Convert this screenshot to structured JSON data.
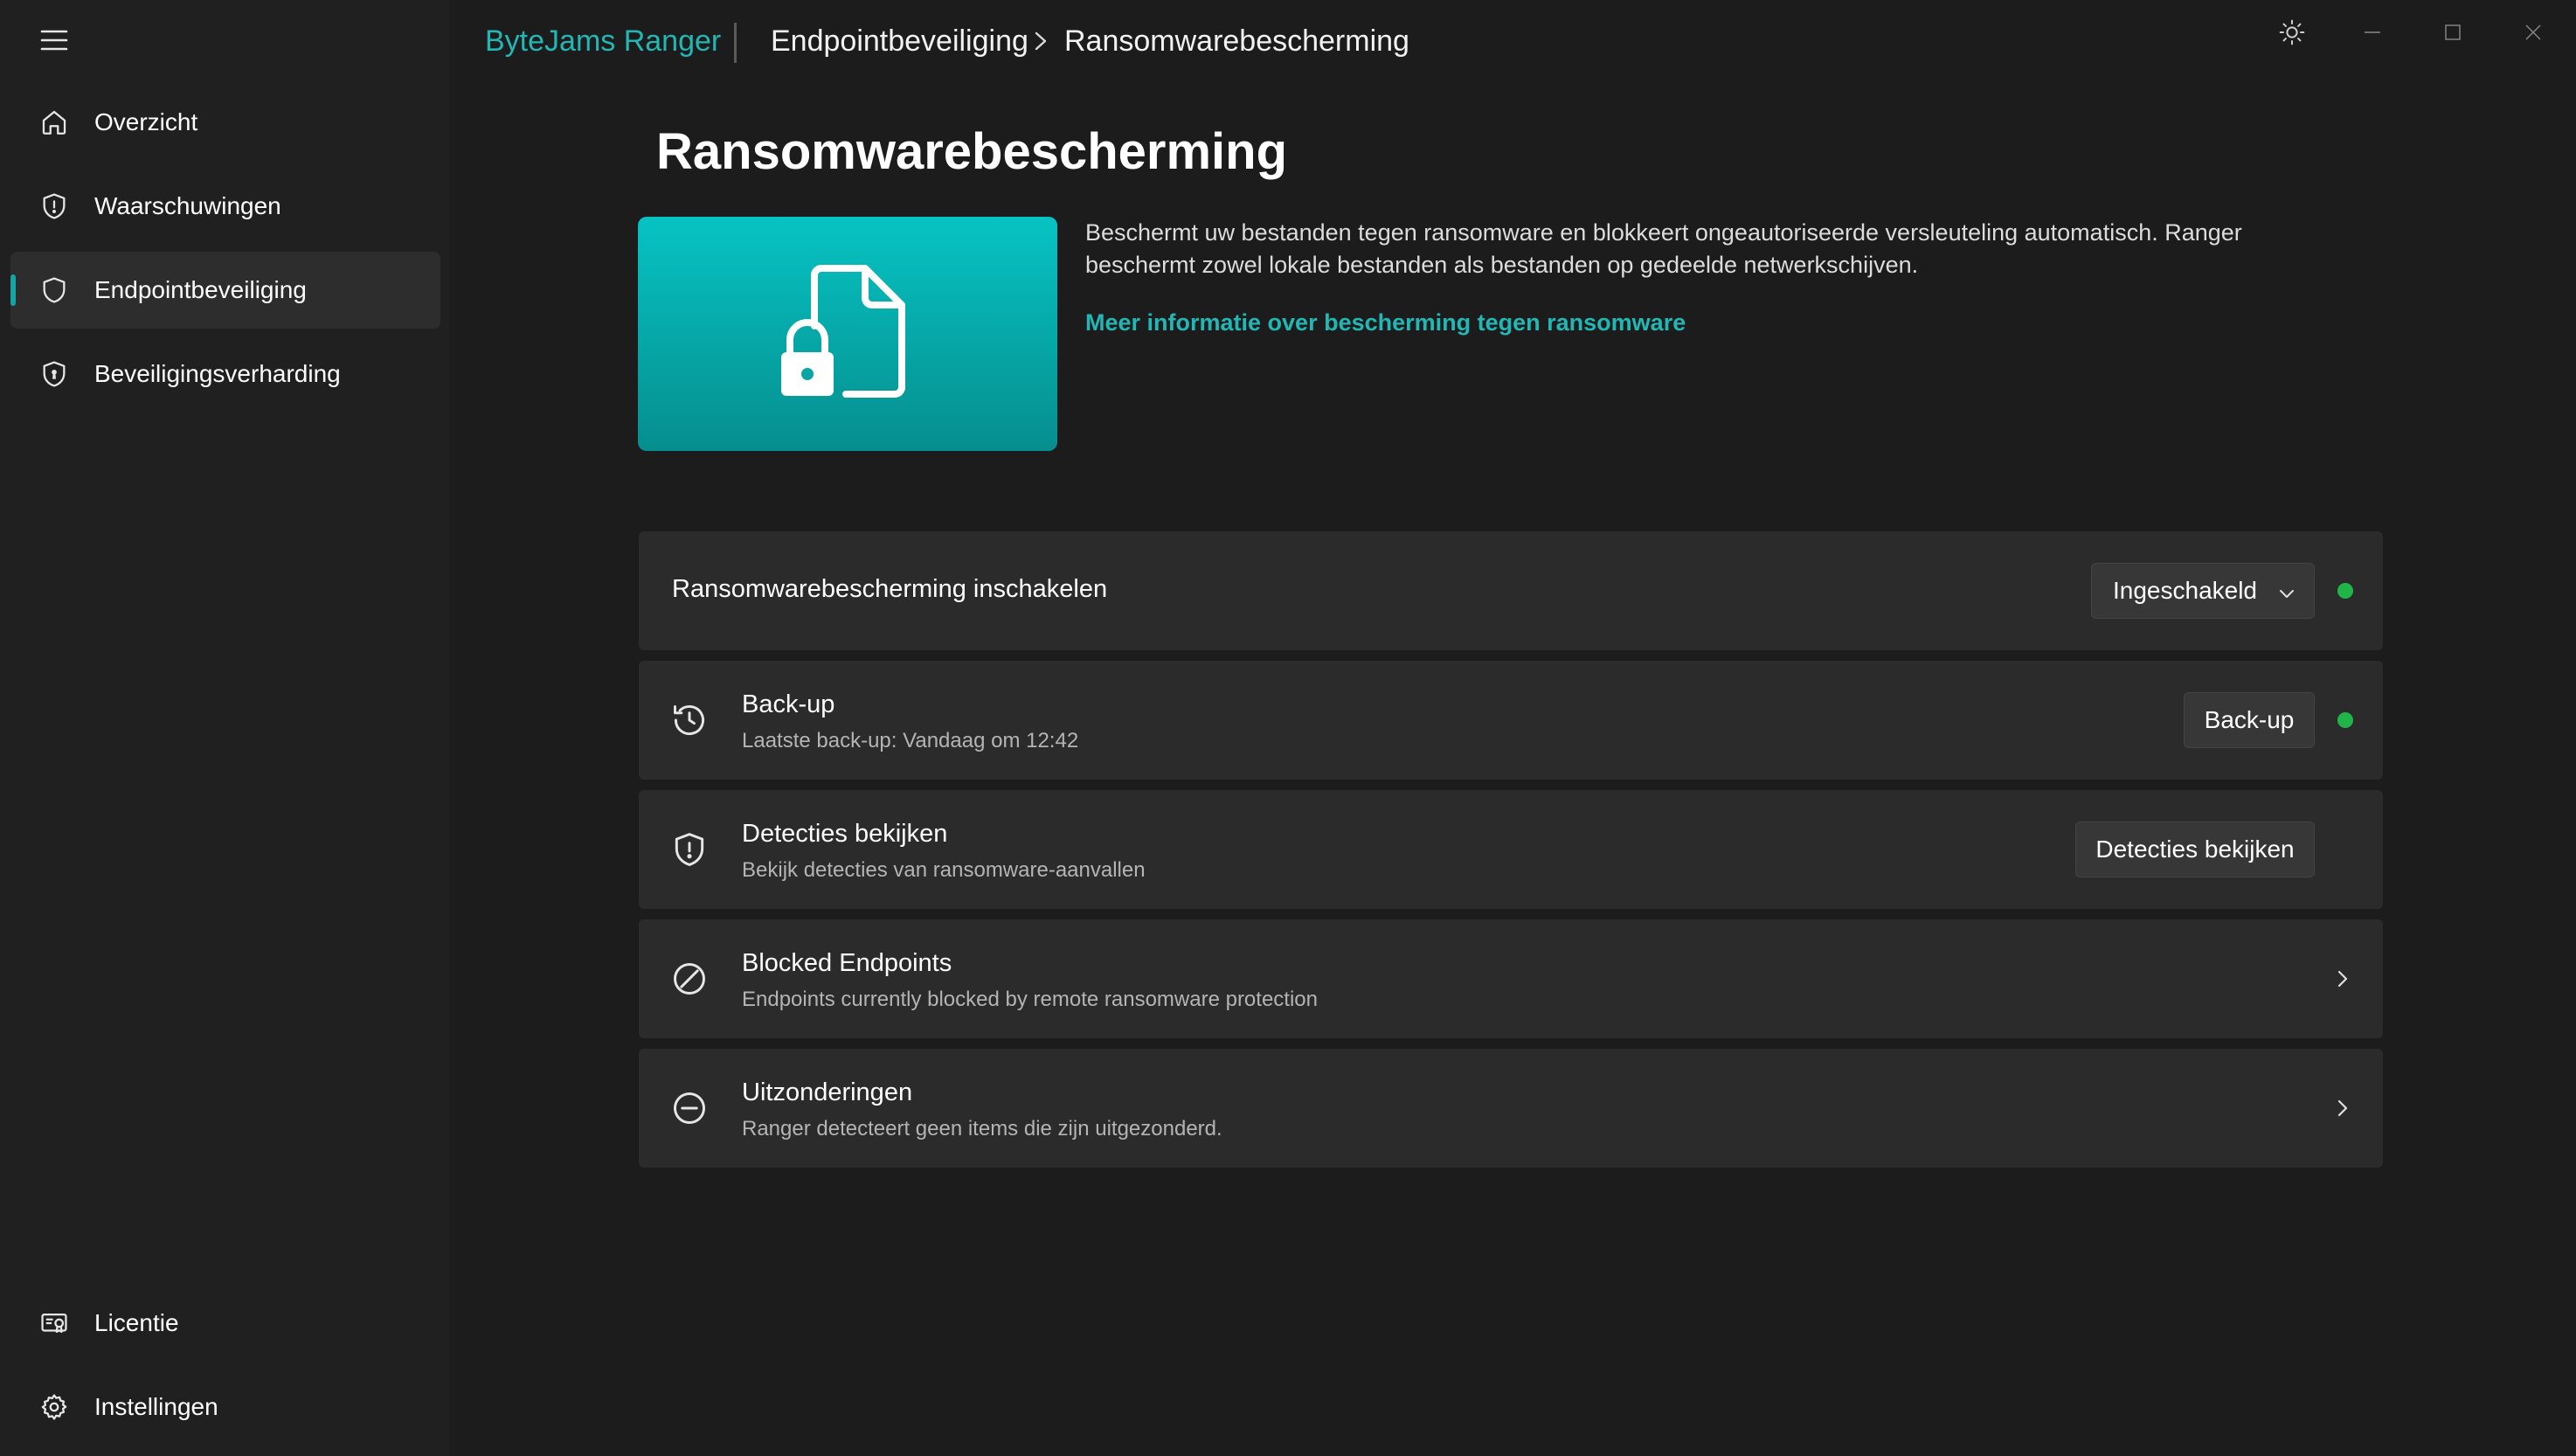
{
  "window": {
    "brand": "ByteJams Ranger",
    "breadcrumb": [
      "Endpointbeveiliging",
      "Ransomwarebescherming"
    ]
  },
  "sidebar": {
    "items": [
      {
        "label": "Overzicht",
        "icon": "home-icon"
      },
      {
        "label": "Waarschuwingen",
        "icon": "shield-icon"
      },
      {
        "label": "Endpointbeveiliging",
        "icon": "shield-icon",
        "active": true
      },
      {
        "label": "Beveiligingsverharding",
        "icon": "shield-lock-icon"
      }
    ],
    "bottom": [
      {
        "label": "Licentie",
        "icon": "license-icon"
      },
      {
        "label": "Instellingen",
        "icon": "gear-icon"
      }
    ]
  },
  "page": {
    "title": "Ransomwarebescherming",
    "description": "Beschermt uw bestanden tegen ransomware en blokkeert ongeautoriseerde versleuteling automatisch. Ranger beschermt zowel lokale bestanden als bestanden op gedeelde netwerkschijven.",
    "link": "Meer informatie over bescherming tegen ransomware"
  },
  "cards": {
    "enable": {
      "title": "Ransomwarebescherming inschakelen",
      "select_value": "Ingeschakeld"
    },
    "backup": {
      "title": "Back-up",
      "subtitle": "Laatste back-up: Vandaag om 12:42",
      "button": "Back-up"
    },
    "detections": {
      "title": "Detecties bekijken",
      "subtitle": "Bekijk detecties van ransomware-aanvallen",
      "button": "Detecties bekijken"
    },
    "blocked": {
      "title": "Blocked Endpoints",
      "subtitle": "Endpoints currently blocked by remote ransomware protection"
    },
    "exclusions": {
      "title": "Uitzonderingen",
      "subtitle": "Ranger detecteert geen items die zijn uitgezonderd."
    }
  },
  "colors": {
    "accent": "#22b7b4",
    "status_ok": "#20b548"
  }
}
